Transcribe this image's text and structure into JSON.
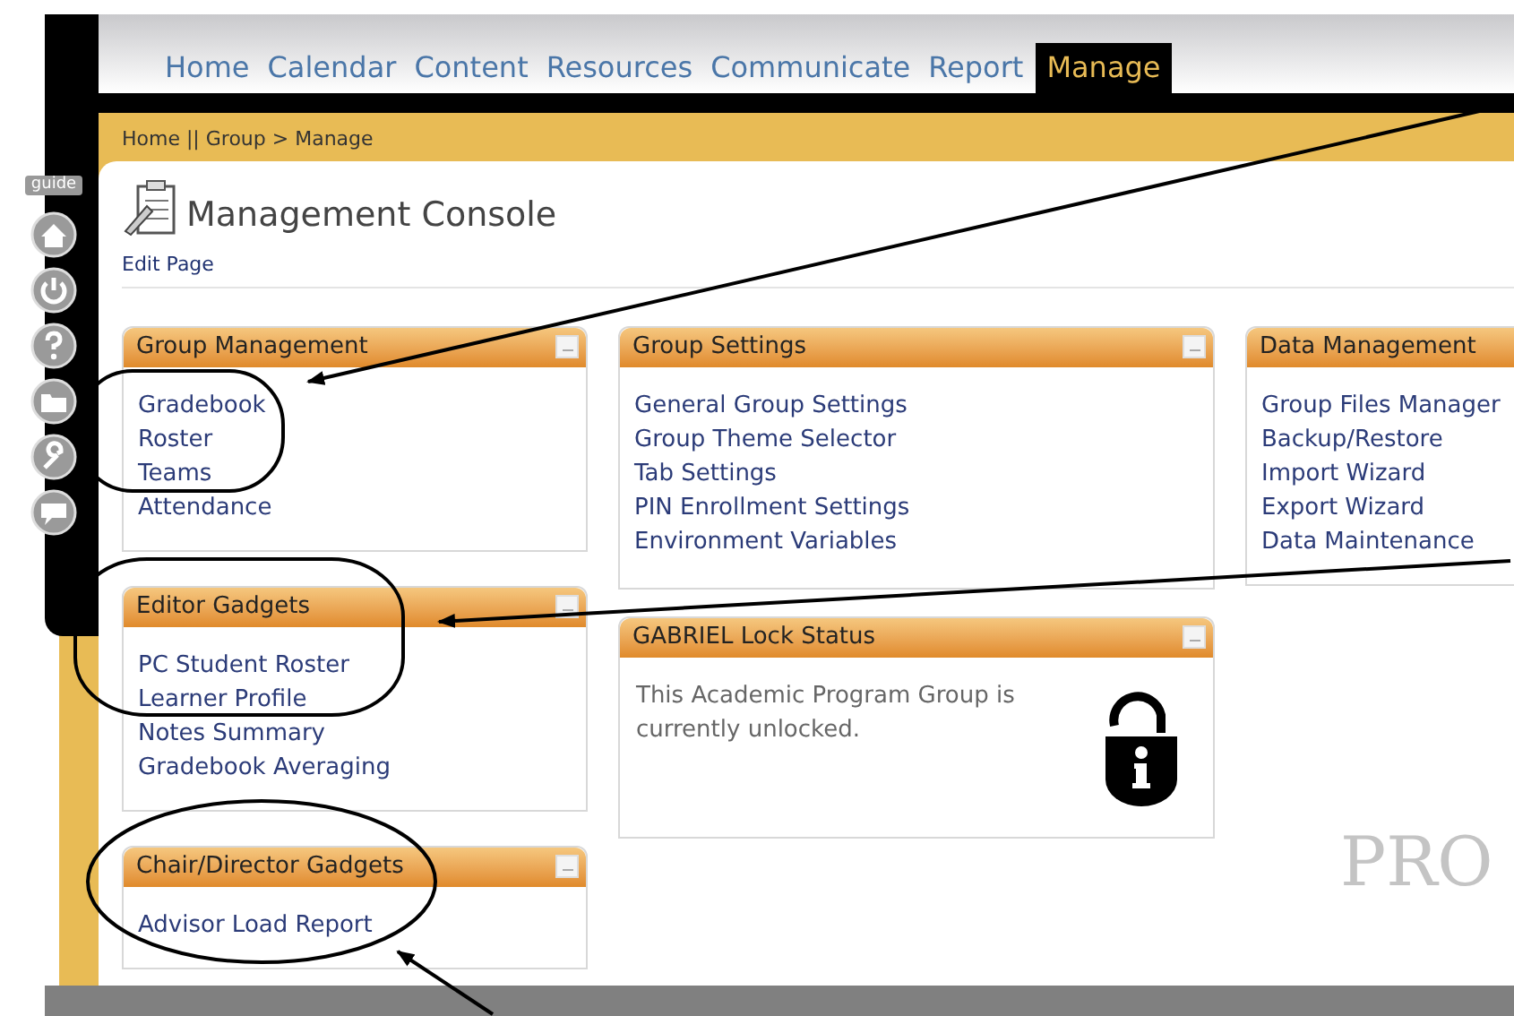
{
  "nav_tabs": [
    {
      "label": "Home",
      "selected": false
    },
    {
      "label": "Calendar",
      "selected": false
    },
    {
      "label": "Content",
      "selected": false
    },
    {
      "label": "Resources",
      "selected": false
    },
    {
      "label": "Communicate",
      "selected": false
    },
    {
      "label": "Report",
      "selected": false
    },
    {
      "label": "Manage",
      "selected": true
    }
  ],
  "breadcrumb": "Home || Group > Manage",
  "sidebar": {
    "guide_label": "guide"
  },
  "page": {
    "title": "Management Console",
    "edit_link": "Edit Page"
  },
  "columns": [
    {
      "panels": [
        {
          "kind": "links",
          "title": "Group Management",
          "items": [
            "Gradebook",
            "Roster",
            "Teams",
            "Attendance"
          ]
        },
        {
          "kind": "links",
          "title": "Editor Gadgets",
          "items": [
            "PC Student Roster",
            "Learner Profile",
            "Notes Summary",
            "Gradebook Averaging"
          ]
        },
        {
          "kind": "links",
          "title": "Chair/Director Gadgets",
          "items": [
            "Advisor Load Report"
          ]
        }
      ]
    },
    {
      "panels": [
        {
          "kind": "links",
          "title": "Group Settings",
          "items": [
            "General Group Settings",
            "Group Theme Selector",
            "Tab Settings",
            "PIN Enrollment Settings",
            "Environment Variables"
          ]
        },
        {
          "kind": "status",
          "title": "GABRIEL Lock Status",
          "message": "This Academic Program Group is currently unlocked.",
          "locked": false
        }
      ]
    },
    {
      "panels": [
        {
          "kind": "links",
          "title": "Data Management",
          "items": [
            "Group Files Manager",
            "Backup/Restore",
            "Import Wizard",
            "Export Wizard",
            "Data Maintenance"
          ]
        }
      ]
    }
  ],
  "background_logo_text": "PRO"
}
